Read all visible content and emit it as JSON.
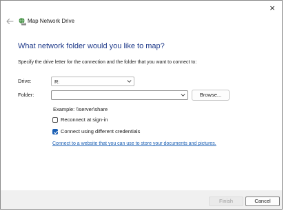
{
  "window": {
    "title": "Map Network Drive",
    "close_glyph": "×"
  },
  "heading": "What network folder would you like to map?",
  "instructions": "Specify the drive letter for the connection and the folder that you want to connect to:",
  "drive": {
    "label": "Drive:",
    "value": "R:"
  },
  "folder": {
    "label": "Folder:",
    "value": "",
    "browse_label": "Browse..."
  },
  "example": "Example: \\\\server\\share",
  "options": {
    "reconnect": {
      "label": "Reconnect at sign-in",
      "checked": false
    },
    "credentials": {
      "label": "Connect using different credentials",
      "checked": true
    }
  },
  "link": "Connect to a website that you can use to store your documents and pictures.",
  "footer": {
    "finish_label": "Finish",
    "cancel_label": "Cancel"
  },
  "icons": {
    "back": "arrow-left-icon",
    "title": "network-drive-icon",
    "close": "close-icon",
    "dropdown": "chevron-down-icon",
    "checkmark": "checkmark-icon"
  },
  "colors": {
    "heading": "#1f3a8a",
    "accent": "#1a5fb4",
    "footer_bg": "#f0f0f0"
  }
}
